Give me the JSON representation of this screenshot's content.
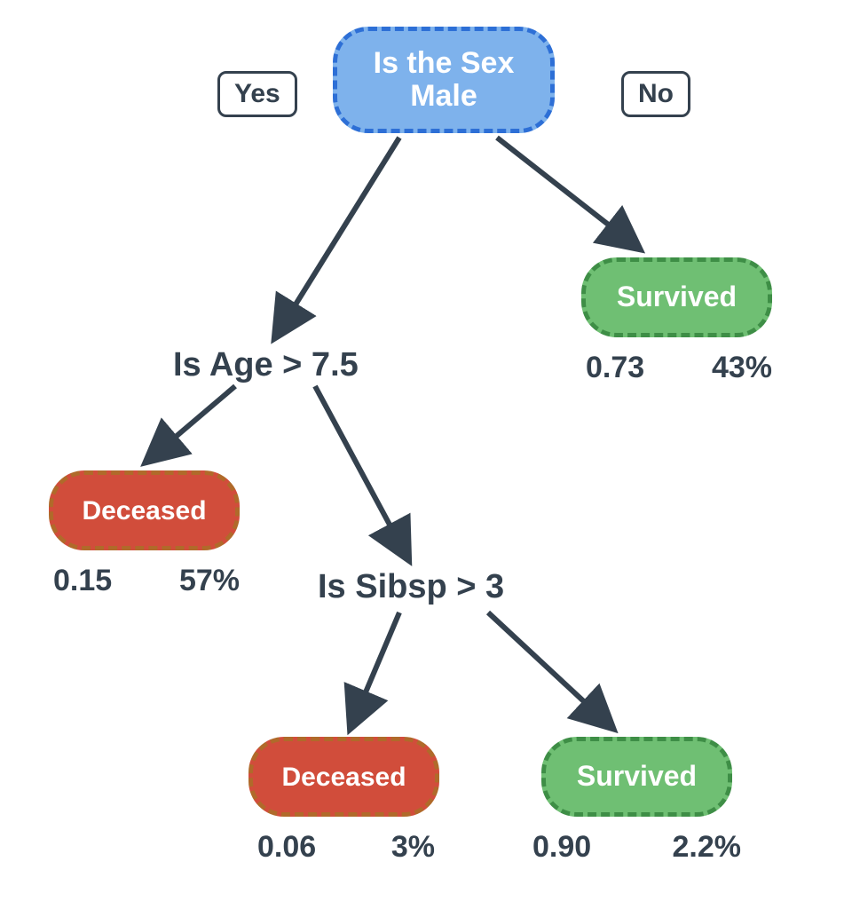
{
  "root": {
    "question_line1": "Is the Sex",
    "question_line2": "Male",
    "branch_yes": "Yes",
    "branch_no": "No"
  },
  "questions": {
    "age": "Is Age > 7.5",
    "sibsp": "Is Sibsp > 3"
  },
  "leaves": {
    "survived_no_branch": {
      "label": "Survived",
      "prob": "0.73",
      "pct": "43%"
    },
    "deceased_age_yes": {
      "label": "Deceased",
      "prob": "0.15",
      "pct": "57%"
    },
    "deceased_sibsp_yes": {
      "label": "Deceased",
      "prob": "0.06",
      "pct": "3%"
    },
    "survived_sibsp_no": {
      "label": "Survived",
      "prob": "0.90",
      "pct": "2.2%"
    }
  },
  "colors": {
    "root_fill": "#7EB2EC",
    "root_border": "#2D6FD6",
    "survived_fill": "#6FBF73",
    "survived_border": "#3E8E46",
    "deceased_fill": "#D14D3B",
    "deceased_border": "#B06A2A",
    "text_dark": "#34414E"
  }
}
